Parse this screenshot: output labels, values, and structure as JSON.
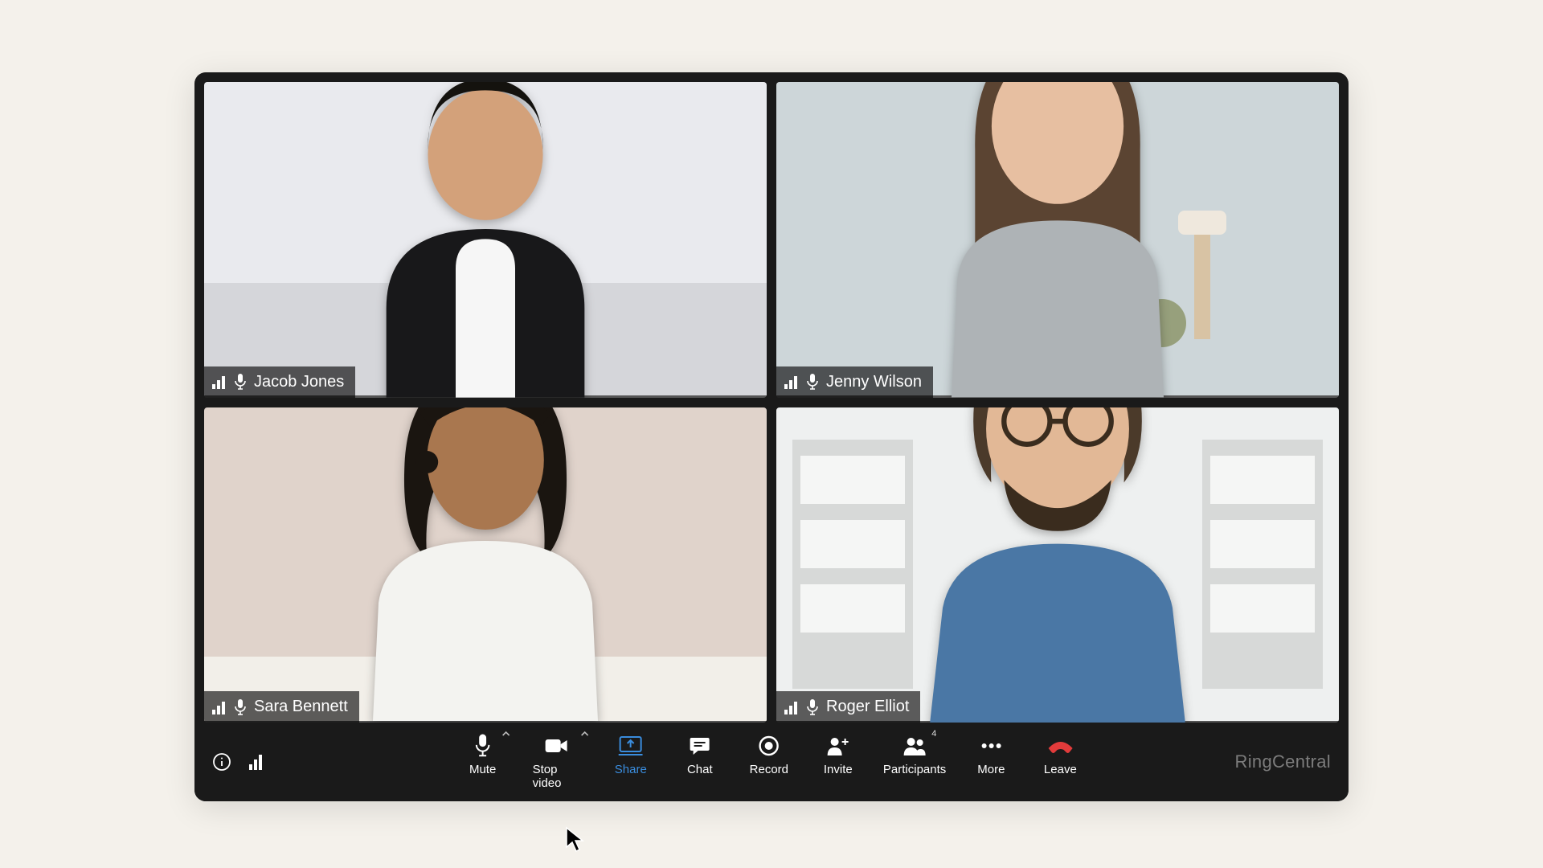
{
  "participants": [
    {
      "name": "Jacob Jones"
    },
    {
      "name": "Jenny Wilson"
    },
    {
      "name": "Sara Bennett"
    },
    {
      "name": "Roger Elliot"
    }
  ],
  "toolbar": {
    "mute": "Mute",
    "stop_video": "Stop video",
    "share": "Share",
    "chat": "Chat",
    "record": "Record",
    "invite": "Invite",
    "participants": "Participants",
    "participants_count": "4",
    "more": "More",
    "leave": "Leave"
  },
  "brand": "RingCentral"
}
